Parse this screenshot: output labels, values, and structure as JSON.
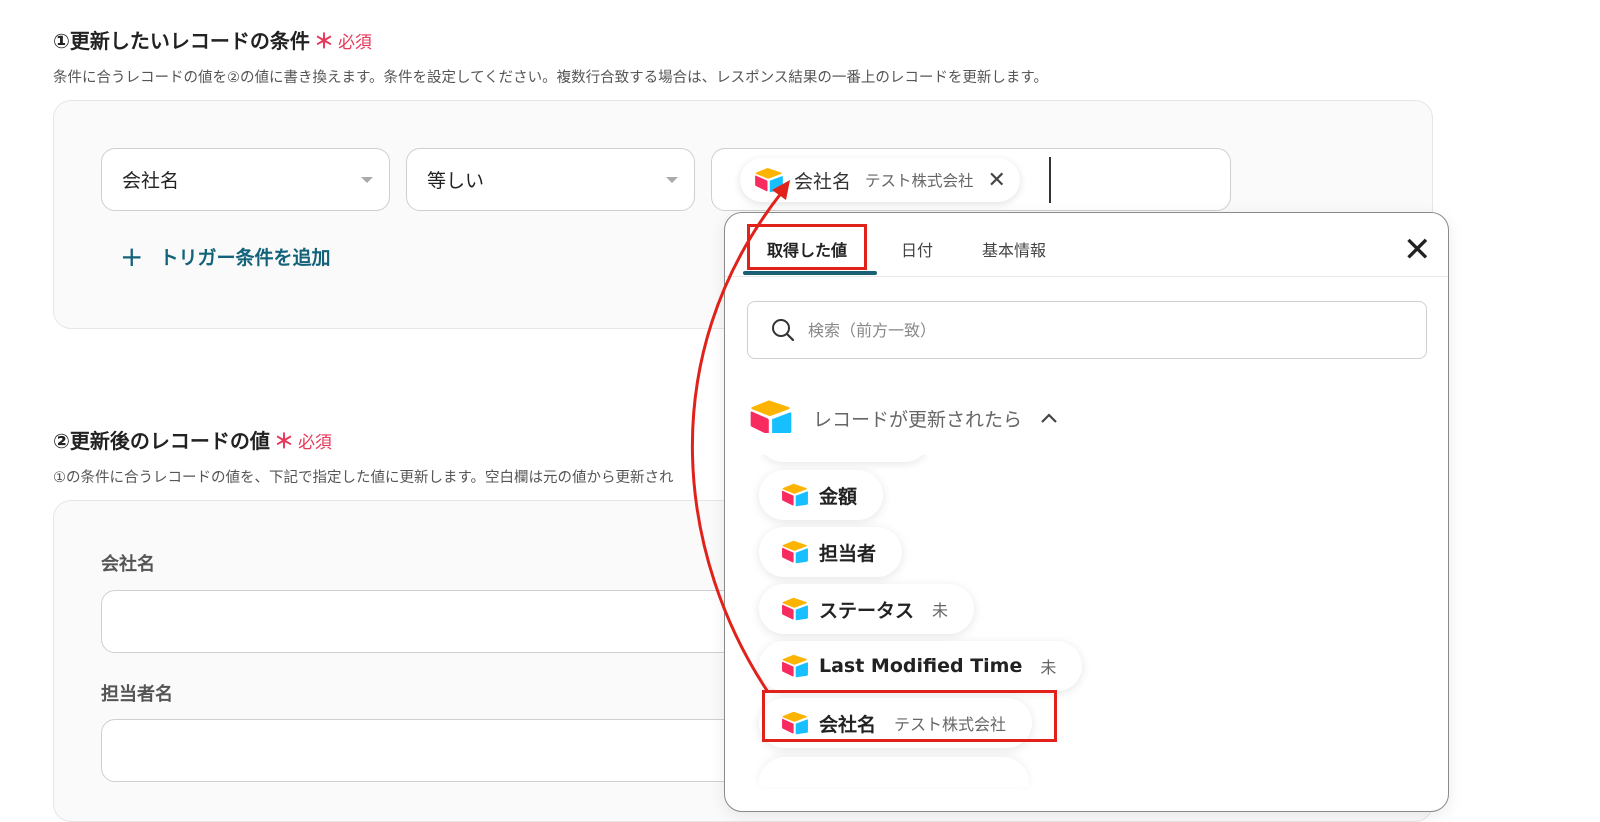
{
  "section1": {
    "title": "①更新したいレコードの条件",
    "required_star": "＊",
    "required_text": "必須",
    "description": "条件に合うレコードの値を②の値に書き換えます。条件を設定してください。複数行合致する場合は、レスポンス結果の一番上のレコードを更新します。",
    "field_select": "会社名",
    "operator_select": "等しい",
    "value_chip": {
      "label": "会社名",
      "sub": "テスト株式会社",
      "remove": "✕"
    },
    "add_condition": {
      "plus": "+",
      "label": "トリガー条件を追加"
    }
  },
  "section2": {
    "title": "②更新後のレコードの値",
    "required_star": "＊",
    "required_text": "必須",
    "description": "①の条件に合うレコードの値を、下記で指定した値に更新します。空白欄は元の値から更新され",
    "fields": [
      {
        "label": "会社名",
        "value": ""
      },
      {
        "label": "担当者名",
        "value": ""
      }
    ]
  },
  "popup": {
    "tabs": [
      {
        "label": "取得した値",
        "active": true
      },
      {
        "label": "日付",
        "active": false
      },
      {
        "label": "基本情報",
        "active": false
      }
    ],
    "close": "✕",
    "search_placeholder": "検索（前方一致）",
    "group_title": "レコードが更新されたら",
    "items": [
      {
        "label": "金額",
        "sub": ""
      },
      {
        "label": "担当者",
        "sub": ""
      },
      {
        "label": "ステータス",
        "sub": "未"
      },
      {
        "label": "Last Modified Time",
        "sub": "未"
      },
      {
        "label": "会社名",
        "sub": "テスト株式会社"
      }
    ]
  },
  "colors": {
    "required": "#e8385a",
    "accent": "#12627a",
    "tab_underline": "#1a5f73",
    "highlight": "#e0221b",
    "logo_yellow": "#fcb400",
    "logo_blue": "#18bfff",
    "logo_red": "#f82b60"
  }
}
